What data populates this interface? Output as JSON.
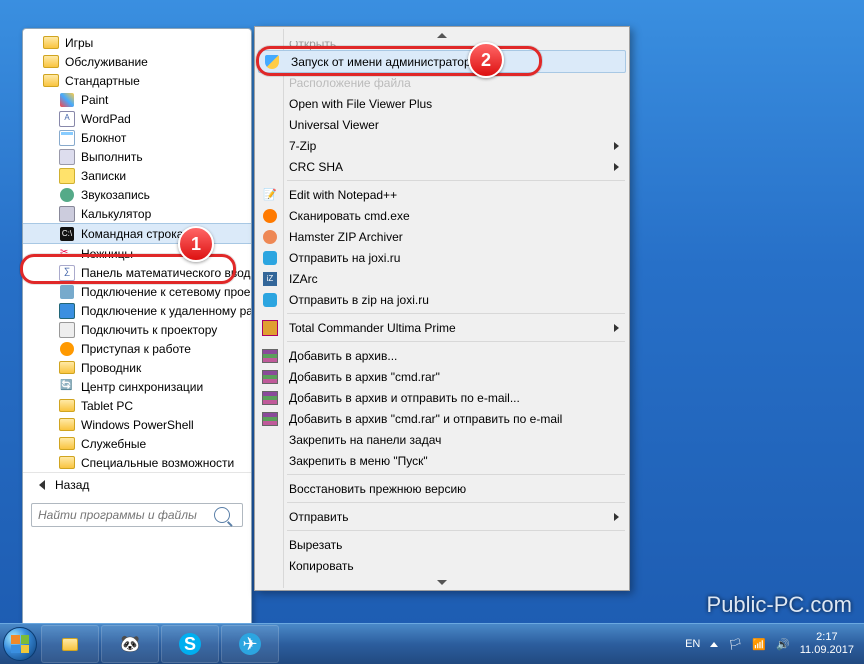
{
  "watermark": "Public-PC.com",
  "start_menu": {
    "items": [
      {
        "label": "Игры",
        "type": "folder",
        "indent": 0
      },
      {
        "label": "Обслуживание",
        "type": "folder",
        "indent": 0
      },
      {
        "label": "Стандартные",
        "type": "folder",
        "indent": 0,
        "open": true
      },
      {
        "label": "Paint",
        "type": "app",
        "indent": 1,
        "icon": "paint"
      },
      {
        "label": "WordPad",
        "type": "app",
        "indent": 1,
        "icon": "wordpad"
      },
      {
        "label": "Блокнот",
        "type": "app",
        "indent": 1,
        "icon": "notepad"
      },
      {
        "label": "Выполнить",
        "type": "app",
        "indent": 1,
        "icon": "run"
      },
      {
        "label": "Записки",
        "type": "app",
        "indent": 1,
        "icon": "sticky"
      },
      {
        "label": "Звукозапись",
        "type": "app",
        "indent": 1,
        "icon": "sound"
      },
      {
        "label": "Калькулятор",
        "type": "app",
        "indent": 1,
        "icon": "calc"
      },
      {
        "label": "Командная строка",
        "type": "app",
        "indent": 1,
        "icon": "cmd",
        "selected": true
      },
      {
        "label": "Ножницы",
        "type": "app",
        "indent": 1,
        "icon": "snip"
      },
      {
        "label": "Панель математического ввода",
        "type": "app",
        "indent": 1,
        "icon": "math"
      },
      {
        "label": "Подключение к сетевому проектору",
        "type": "app",
        "indent": 1,
        "icon": "netproj"
      },
      {
        "label": "Подключение к удаленному рабочему столу",
        "type": "app",
        "indent": 1,
        "icon": "rdp"
      },
      {
        "label": "Подключить к проектору",
        "type": "app",
        "indent": 1,
        "icon": "proj"
      },
      {
        "label": "Приступая к работе",
        "type": "app",
        "indent": 1,
        "icon": "start"
      },
      {
        "label": "Проводник",
        "type": "app",
        "indent": 1,
        "icon": "explorer"
      },
      {
        "label": "Центр синхронизации",
        "type": "app",
        "indent": 1,
        "icon": "sync"
      },
      {
        "label": "Tablet PC",
        "type": "folder",
        "indent": 1
      },
      {
        "label": "Windows PowerShell",
        "type": "folder",
        "indent": 1
      },
      {
        "label": "Служебные",
        "type": "folder",
        "indent": 1
      },
      {
        "label": "Специальные возможности",
        "type": "folder",
        "indent": 1
      }
    ],
    "back_label": "Назад",
    "search_placeholder": "Найти программы и файлы"
  },
  "annotations": {
    "badge1": "1",
    "badge2": "2"
  },
  "context_menu": {
    "groups": [
      [
        {
          "label": "Открыть",
          "truncated_top": true
        },
        {
          "label": "Запуск от имени администратора",
          "icon": "shield",
          "highlight": true
        },
        {
          "label": "Расположение файла",
          "dim": true
        },
        {
          "label": "Open with File Viewer Plus"
        },
        {
          "label": "Universal Viewer"
        },
        {
          "label": "7-Zip",
          "submenu": true
        },
        {
          "label": "CRC SHA",
          "submenu": true
        }
      ],
      [
        {
          "label": "Edit with Notepad++",
          "icon": "npp"
        },
        {
          "label": "Сканировать cmd.exe",
          "icon": "avast"
        },
        {
          "label": "Hamster ZIP Archiver",
          "icon": "hamster"
        },
        {
          "label": "Отправить на joxi.ru",
          "icon": "joxi"
        },
        {
          "label": "IZArc",
          "icon": "izarc"
        },
        {
          "label": "Отправить в zip на joxi.ru",
          "icon": "joxi"
        }
      ],
      [
        {
          "label": "Total Commander Ultima Prime",
          "icon": "tc",
          "submenu": true
        }
      ],
      [
        {
          "label": "Добавить в архив...",
          "icon": "rar"
        },
        {
          "label": "Добавить в архив \"cmd.rar\"",
          "icon": "rar"
        },
        {
          "label": "Добавить в архив и отправить по e-mail...",
          "icon": "rar"
        },
        {
          "label": "Добавить в архив \"cmd.rar\" и отправить по e-mail",
          "icon": "rar"
        },
        {
          "label": "Закрепить на панели задач"
        },
        {
          "label": "Закрепить в меню \"Пуск\""
        }
      ],
      [
        {
          "label": "Восстановить прежнюю версию"
        }
      ],
      [
        {
          "label": "Отправить",
          "submenu": true
        }
      ],
      [
        {
          "label": "Вырезать"
        },
        {
          "label": "Копировать"
        }
      ]
    ]
  },
  "taskbar": {
    "lang": "EN",
    "time": "2:17",
    "date": "11.09.2017"
  }
}
